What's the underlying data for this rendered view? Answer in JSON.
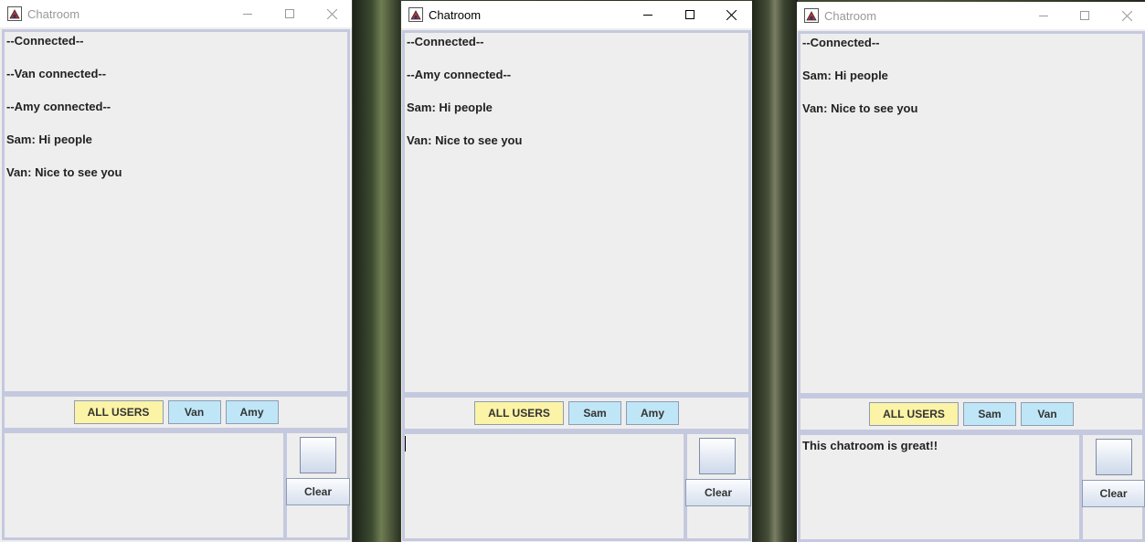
{
  "windows": [
    {
      "title": "Chatroom",
      "messages": [
        "--Connected--",
        "--Van connected--",
        "--Amy connected--",
        "Sam: Hi people",
        "Van: Nice to see you"
      ],
      "all_users_label": "ALL USERS",
      "users": [
        "Van",
        "Amy"
      ],
      "input_text": "",
      "clear_label": "Clear"
    },
    {
      "title": "Chatroom",
      "messages": [
        "--Connected--",
        "--Amy connected--",
        "Sam: Hi people",
        "Van: Nice to see you"
      ],
      "all_users_label": "ALL USERS",
      "users": [
        "Sam",
        "Amy"
      ],
      "input_text": "",
      "clear_label": "Clear"
    },
    {
      "title": "Chatroom",
      "messages": [
        "--Connected--",
        "Sam: Hi people",
        "Van: Nice to see you"
      ],
      "all_users_label": "ALL USERS",
      "users": [
        "Sam",
        "Van"
      ],
      "input_text": "This chatroom is great!!",
      "clear_label": "Clear"
    }
  ],
  "colors": {
    "all_users_button": "#fbf3a6",
    "user_button": "#bfe6f6",
    "panel_border": "#c5c9df",
    "panel_background": "#eeeeee"
  },
  "icons": [
    "app-icon",
    "minimize-icon",
    "maximize-icon",
    "close-icon"
  ]
}
